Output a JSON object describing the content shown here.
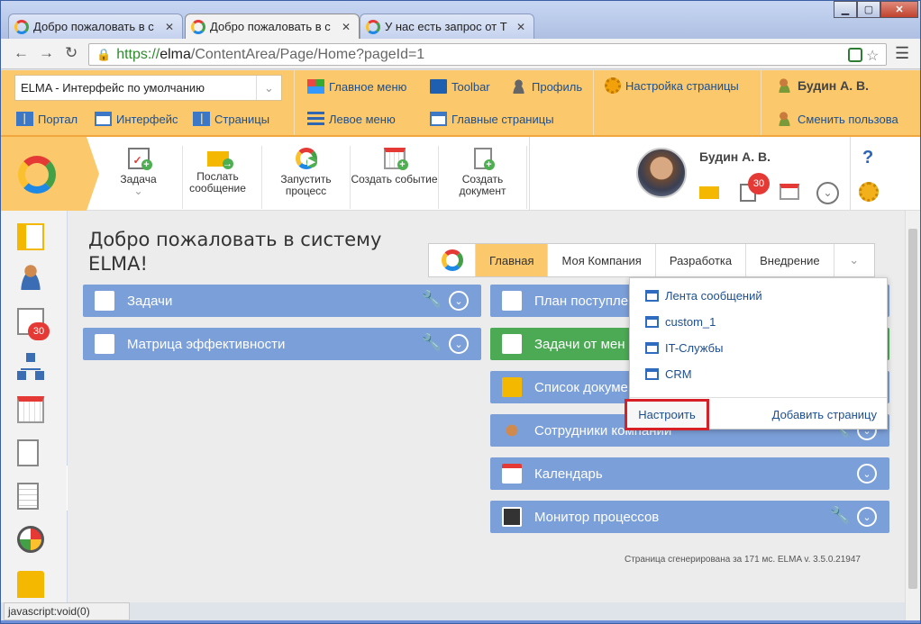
{
  "browser": {
    "tabs": [
      {
        "title": "Добро пожаловать в с"
      },
      {
        "title": "Добро пожаловать в с"
      },
      {
        "title": "У нас есть запрос от Т"
      }
    ],
    "tab_close": "✕",
    "address": {
      "scheme": "https://",
      "host": "elma",
      "path": "/ContentArea/Page/Home?pageId=1"
    }
  },
  "top_panel": {
    "interface_select": "ELMA  - Интерфейс по умолчанию",
    "links": {
      "portal": "Портал",
      "interface": "Интерфейс",
      "pages": "Страницы",
      "main_menu": "Главное меню",
      "toolbar": "Toolbar",
      "profile": "Профиль",
      "left_menu": "Левое меню",
      "main_pages": "Главные страницы",
      "page_settings": "Настройка страницы",
      "user": "Будин А. В.",
      "change_user": "Сменить пользова"
    }
  },
  "header": {
    "actions": [
      {
        "label": "Задача"
      },
      {
        "label": "Послать сообщение"
      },
      {
        "label": "Запустить процесс"
      },
      {
        "label": "Создать событие"
      },
      {
        "label": "Создать документ"
      }
    ],
    "user_name": "Будин А. В.",
    "task_badge": "30",
    "help": "?"
  },
  "sidebar": {
    "task_badge": "30"
  },
  "main": {
    "title": "Добро пожаловать в систему ELMA!",
    "page_tabs": [
      "Главная",
      "Моя Компания",
      "Разработка",
      "Внедрение"
    ],
    "left_portlets": [
      "Задачи",
      "Матрица эффективности"
    ],
    "right_portlets": [
      "План поступле",
      "Задачи от мен",
      "Список докуме",
      "Сотрудники компании",
      "Календарь",
      "Монитор процессов"
    ],
    "generated": "Страница сгенерирована за 171 мс. ELMA v. 3.5.0.21947"
  },
  "dropdown": {
    "items": [
      "Лента сообщений",
      "custom_1",
      "IT-Службы",
      "CRM"
    ],
    "configure": "Настроить",
    "add_page": "Добавить страницу"
  },
  "status_bar": "javascript:void(0)",
  "colors": {
    "accent": "#fbc86c",
    "portlet_blue": "#7b9fd8",
    "portlet_green": "#4caa55",
    "highlight_red": "#d61f26"
  }
}
